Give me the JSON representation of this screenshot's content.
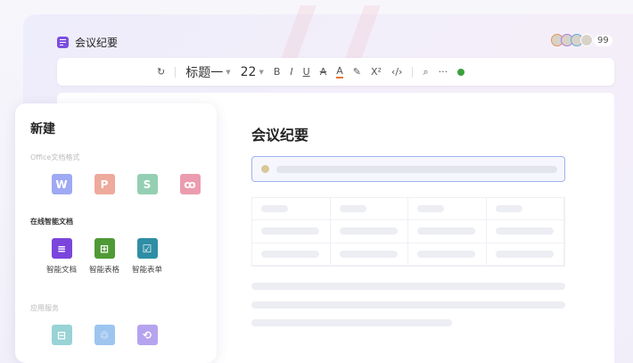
{
  "document": {
    "title": "会议纪要",
    "heading": "会议纪要"
  },
  "collaborators": {
    "count": "99",
    "colors": [
      "#e0965f",
      "#b07be0",
      "#5fb0d8",
      "#888"
    ]
  },
  "toolbar": {
    "heading_style": "标题一",
    "font_size": "22",
    "bold": "B",
    "italic": "I",
    "underline": "U",
    "strike": "A",
    "color": "A",
    "highlight": "✎",
    "superscript": "X²",
    "code": "‹/›",
    "search": "⌕",
    "more": "···"
  },
  "new_panel": {
    "title": "新建",
    "office_label": "Office文档格式",
    "office": [
      {
        "letter": "W",
        "color": "#9eaaf3"
      },
      {
        "letter": "P",
        "color": "#eeaa9c"
      },
      {
        "letter": "S",
        "color": "#94cfb3"
      },
      {
        "letter": "ꝏ",
        "color": "#eb9cae"
      }
    ],
    "smart_label": "在线智能文档",
    "smart": [
      {
        "label": "智能文档",
        "glyph": "≡",
        "color": "#7b45dc"
      },
      {
        "label": "智能表格",
        "glyph": "⊞",
        "color": "#4f9a36"
      },
      {
        "label": "智能表单",
        "glyph": "☑",
        "color": "#2f8ea5"
      }
    ],
    "apps_label": "应用服务",
    "apps": [
      {
        "glyph": "⊟",
        "color": "#98d3d6"
      },
      {
        "glyph": "♲",
        "color": "#9dc5ef"
      },
      {
        "glyph": "⟲",
        "color": "#b6a3ef"
      }
    ]
  }
}
